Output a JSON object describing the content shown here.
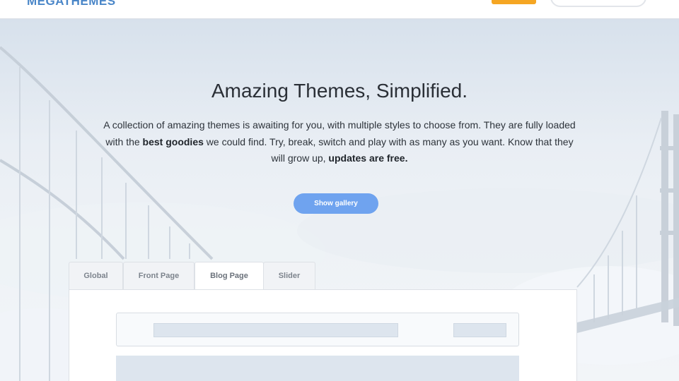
{
  "header": {
    "logo": "MEGATHEMES"
  },
  "hero": {
    "title": "Amazing Themes, Simplified.",
    "description": {
      "part1": "A collection of amazing themes is awaiting for you, with multiple styles to choose from. They are fully loaded with the ",
      "bold1": "best goodies",
      "part2": " we could find. Try, break, switch and play with as many as you want. Know that they will grow up, ",
      "bold2": "updates are free."
    },
    "cta_label": "Show gallery"
  },
  "tabs": [
    {
      "label": "Global",
      "active": false
    },
    {
      "label": "Front Page",
      "active": false
    },
    {
      "label": "Blog Page",
      "active": true
    },
    {
      "label": "Slider",
      "active": false
    }
  ],
  "colors": {
    "accent": "#6fa3ef",
    "orange": "#f5a623",
    "logo": "#4a86c8"
  }
}
